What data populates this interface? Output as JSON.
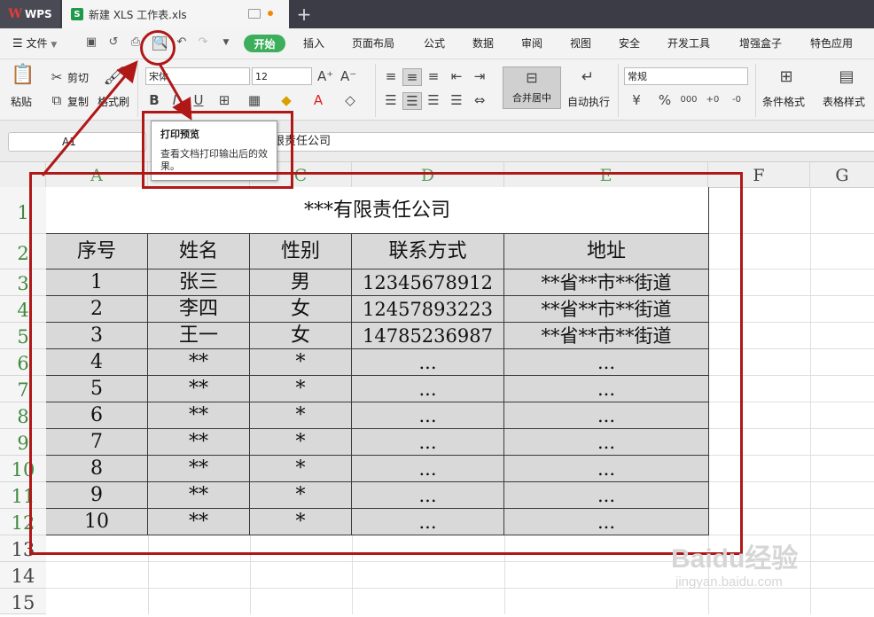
{
  "tabs": {
    "app": "WPS",
    "app_logo": "W",
    "doc": "新建 XLS 工作表.xls",
    "doc_icon": "S",
    "new_tab": "+"
  },
  "menu": {
    "file": "文件",
    "start": "开始",
    "items": [
      "插入",
      "页面布局",
      "公式",
      "数据",
      "审阅",
      "视图",
      "安全",
      "开发工具",
      "增强盒子",
      "特色应用"
    ]
  },
  "ribbon": {
    "paste": "粘贴",
    "cut": "剪切",
    "copy": "复制",
    "format_painter": "格式刷",
    "font_name": "宋体",
    "font_size": "12",
    "bold": "B",
    "underline": "U",
    "merge_center": "合并居中",
    "wrap": "自动执行",
    "number_format": "常规",
    "cond_format": "条件格式",
    "table_style": "表格样式",
    "percent": "%",
    "thousands": "000"
  },
  "tooltip": {
    "title": "打印预览",
    "desc": "查看文档打印输出后的效果。"
  },
  "formula": {
    "cell_ref": "A1",
    "content": "限责任公司"
  },
  "columns": [
    "A",
    "B",
    "C",
    "D",
    "E",
    "F",
    "G"
  ],
  "rows": [
    "1",
    "2",
    "3",
    "4",
    "5",
    "6",
    "7",
    "8",
    "9",
    "10",
    "11",
    "12",
    "13",
    "14",
    "15"
  ],
  "sheet": {
    "title": "***有限责任公司",
    "headers": [
      "序号",
      "姓名",
      "性别",
      "联系方式",
      "地址"
    ],
    "data": [
      [
        "1",
        "张三",
        "男",
        "12345678912",
        "**省**市**街道"
      ],
      [
        "2",
        "李四",
        "女",
        "12457893223",
        "**省**市**街道"
      ],
      [
        "3",
        "王一",
        "女",
        "14785236987",
        "**省**市**街道"
      ],
      [
        "4",
        "**",
        "*",
        "...",
        "..."
      ],
      [
        "5",
        "**",
        "*",
        "...",
        "..."
      ],
      [
        "6",
        "**",
        "*",
        "...",
        "..."
      ],
      [
        "7",
        "**",
        "*",
        "...",
        "..."
      ],
      [
        "8",
        "**",
        "*",
        "...",
        "..."
      ],
      [
        "9",
        "**",
        "*",
        "...",
        "..."
      ],
      [
        "10",
        "**",
        "*",
        "...",
        "..."
      ]
    ]
  },
  "watermark": {
    "brand": "Baidu经验",
    "url": "jingyan.baidu.com"
  },
  "colors": {
    "annotation": "#b01818",
    "table_fill": "#d9d9d9",
    "start_green": "#3cae5c",
    "tab_bar": "#3c3c46"
  }
}
